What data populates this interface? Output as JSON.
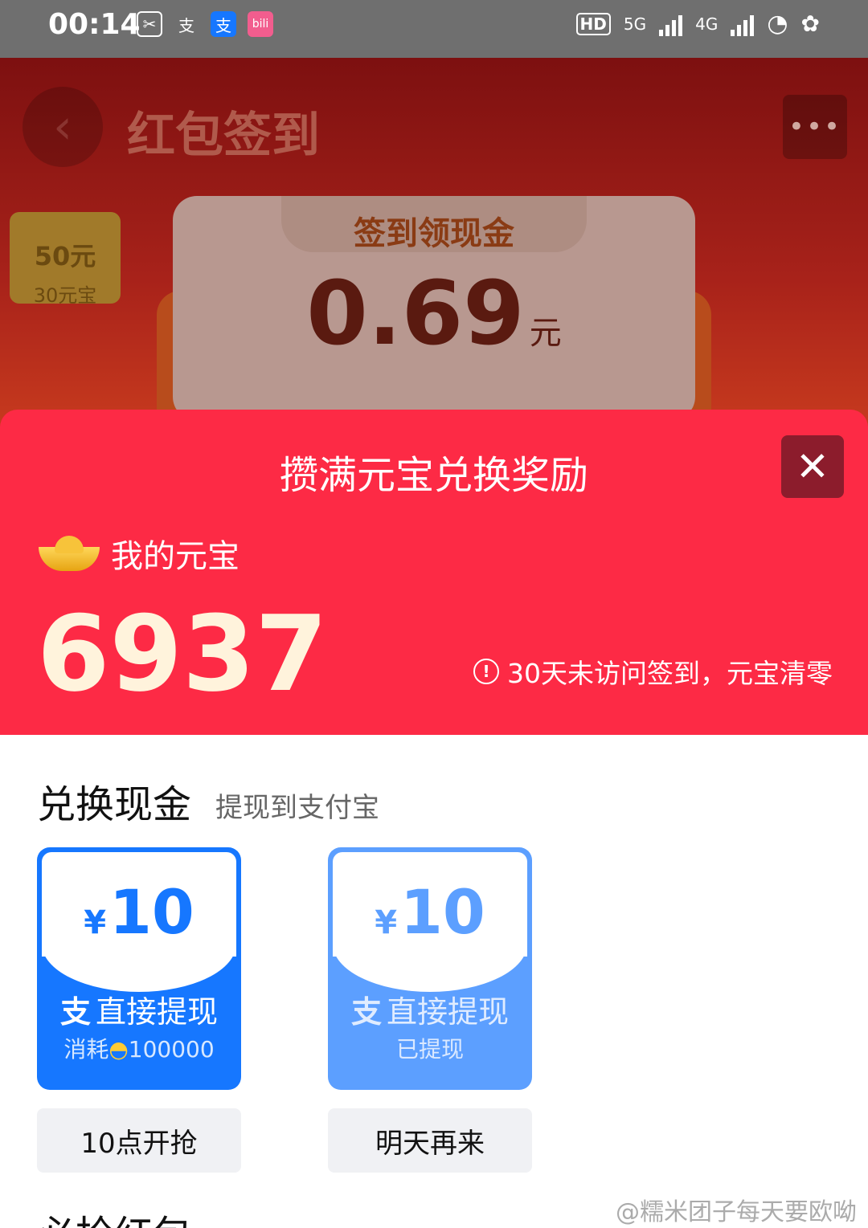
{
  "status_bar": {
    "time": "00:14",
    "net1": "5G",
    "net2": "4G",
    "hd": "HD"
  },
  "background": {
    "title": "红包签到",
    "back_icon": "chevron-left-icon",
    "more_icon": "more-dots-icon",
    "coupon_amount": "50元",
    "coupon_sub": "30元宝",
    "envelope_label": "签到领现金",
    "envelope_amount": "0.69",
    "envelope_unit": "元"
  },
  "modal": {
    "title": "攒满元宝兑换奖励",
    "close_icon": "close-icon",
    "ingot_label": "我的元宝",
    "ingot_count": "6937",
    "warning": "30天未访问签到，元宝清零",
    "section_title": "兑换现金",
    "section_sub": "提现到支付宝",
    "cards": [
      {
        "currency": "¥",
        "amount": "10",
        "alipay_glyph": "支",
        "action": "直接提现",
        "note_prefix": "消耗",
        "note_value": "100000",
        "button": "10点开抢"
      },
      {
        "currency": "¥",
        "amount": "10",
        "alipay_glyph": "支",
        "action": "直接提现",
        "note": "已提现",
        "button": "明天再来"
      }
    ],
    "next_section_partial": "必抢红包"
  },
  "watermark": "@糯米团子每天要欧呦",
  "colors": {
    "modal_red": "#fd2a45",
    "primary_blue": "#1677ff",
    "light_blue": "#5c9fff"
  }
}
